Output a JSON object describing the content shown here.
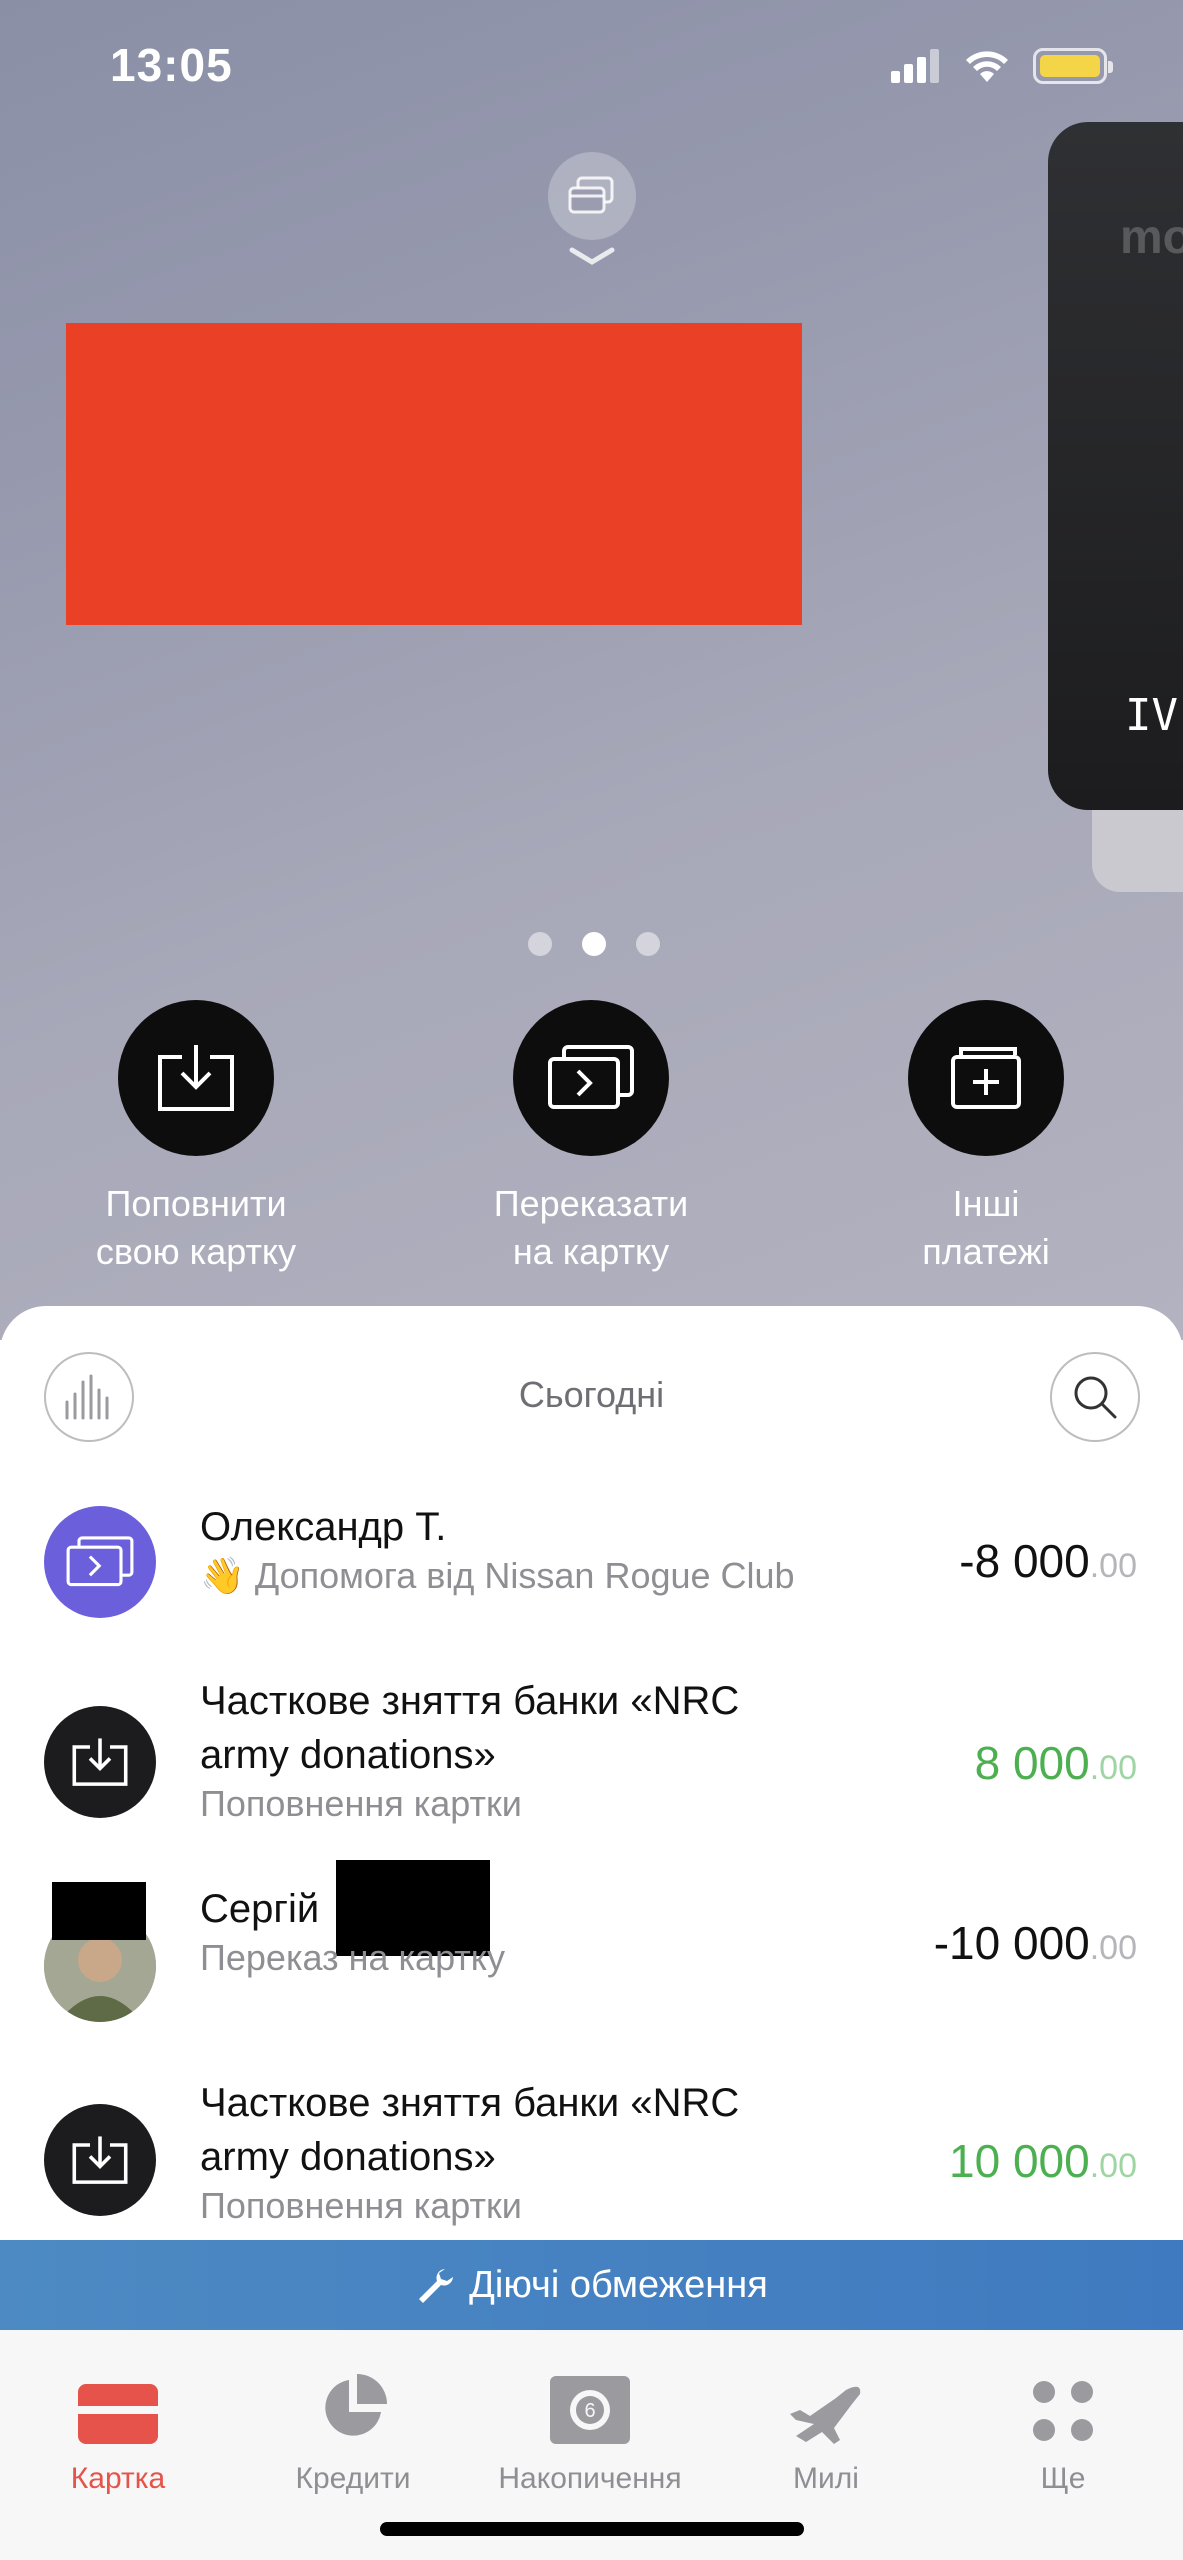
{
  "status": {
    "time": "13:05"
  },
  "card": {
    "brand_partial": "mo",
    "holder_partial": "IV"
  },
  "carousel": {
    "pages": 3,
    "active_index": 1
  },
  "actions": [
    {
      "label": "Поповнити\nсвою картку",
      "icon": "download-tray-icon"
    },
    {
      "label": "Переказати\nна картку",
      "icon": "card-transfer-icon"
    },
    {
      "label": "Інші\nплатежі",
      "icon": "folder-plus-icon"
    }
  ],
  "feed": {
    "title": "Сьогодні",
    "transactions": [
      {
        "title": "Олександр Т.",
        "subtitle": "👋 Допомога від Nissan Rogue Club",
        "amount": "-8 000",
        "cents": ".00",
        "positive": false,
        "icon": "card-transfer-icon",
        "icon_bg": "#6b5fdc"
      },
      {
        "title": "Часткове зняття банки «NRC\narmy donations»",
        "subtitle": "Поповнення картки",
        "amount": "8 000",
        "cents": ".00",
        "positive": true,
        "icon": "download-tray-icon",
        "icon_bg": "#1c1c1e"
      },
      {
        "title": "Сергій",
        "subtitle": "Переказ на картку",
        "amount": "-10 000",
        "cents": ".00",
        "positive": false,
        "icon": "avatar",
        "icon_bg": "#9aa08f"
      },
      {
        "title": "Часткове зняття банки «NRC\narmy donations»",
        "subtitle": "Поповнення картки",
        "amount": "10 000",
        "cents": ".00",
        "positive": true,
        "icon": "download-tray-icon",
        "icon_bg": "#1c1c1e"
      }
    ]
  },
  "banner": {
    "label": "Діючі обмеження",
    "icon": "wrench-icon"
  },
  "tabs": [
    {
      "label": "Картка",
      "active": true,
      "icon": "card-icon"
    },
    {
      "label": "Кредити",
      "active": false,
      "icon": "pie-chart-icon"
    },
    {
      "label": "Накопичення",
      "active": false,
      "icon": "savings-icon"
    },
    {
      "label": "Милі",
      "active": false,
      "icon": "airplane-icon"
    },
    {
      "label": "Ще",
      "active": false,
      "icon": "more-icon"
    }
  ],
  "colors": {
    "accent": "#e5534b",
    "positive": "#4caf50",
    "banner": "#4683c2"
  }
}
